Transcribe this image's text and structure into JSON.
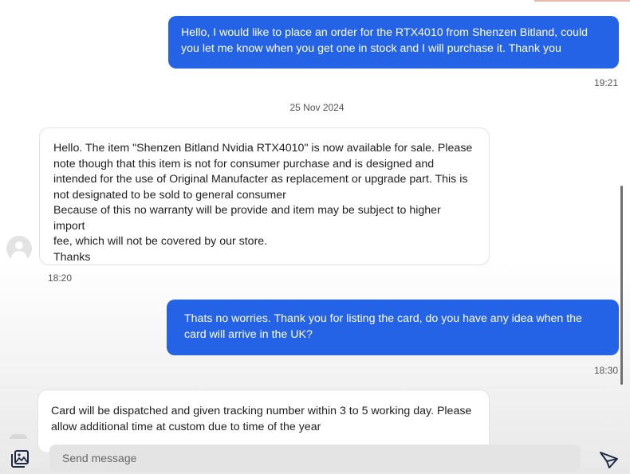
{
  "messages": [
    {
      "direction": "outgoing",
      "text": "Hello, I would like to place an order for the RTX4010 from Shenzen Bitland, could\nyou let me know when you get one in stock and I will purchase it. Thank you",
      "time": "19:21"
    },
    {
      "direction": "incoming",
      "text": "Hello. The item \"Shenzen Bitland Nvidia RTX4010\" is now available for sale. Please\nnote though that this item is not for consumer purchase and is designed and\nintended for the use of Original Manufacter as replacement or upgrade part. This is\nnot designated to be sold to general consumer\nBecause of this no warranty will be provide and item may be subject to higher import\nfee, which will not be covered by our store.\nThanks",
      "time": "18:20"
    },
    {
      "direction": "outgoing",
      "text": "Thats no worries. Thank you for listing the card, do you have any idea when the\ncard will arrive in the UK?",
      "time": "18:30"
    },
    {
      "direction": "incoming",
      "text": "Card will be dispatched and given tracking number within 3 to 5 working day. Please\nallow additional time at custom due to time of the year",
      "time": ""
    }
  ],
  "date_separator": "25 Nov 2024",
  "composer": {
    "placeholder": "Send message",
    "attach_icon": "image-gallery-icon",
    "send_icon": "send-icon"
  },
  "colors": {
    "outgoing_bubble": "#2563e6",
    "incoming_bubble": "#ffffff"
  }
}
